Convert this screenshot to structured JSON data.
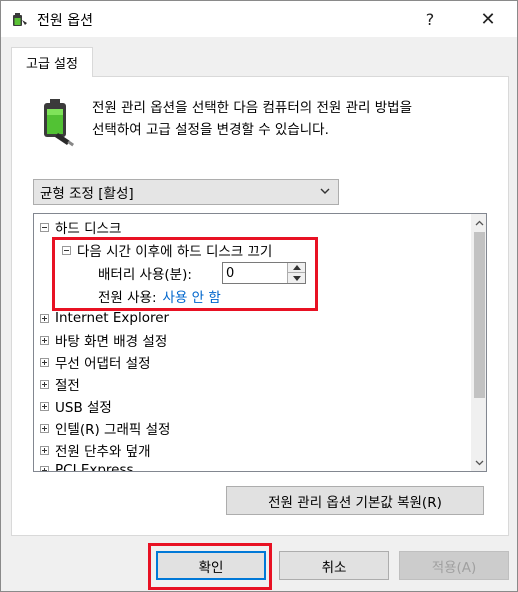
{
  "window": {
    "title": "전원 옵션",
    "help_glyph": "?",
    "close_glyph": "✕"
  },
  "tab": {
    "label": "고급 설정"
  },
  "description": {
    "line1": "전원 관리 옵션을 선택한 다음 컴퓨터의 전원 관리 방법을",
    "line2": "선택하여 고급 설정을 변경할 수 있습니다."
  },
  "plan_dropdown": {
    "value": "균형 조정 [활성]"
  },
  "tree": {
    "hard_disk": "하드 디스크",
    "turn_off_after": "다음 시간 이후에 하드 디스크 끄기",
    "on_battery_label": "배터리 사용(분):",
    "on_battery_value": "0",
    "plugged_in_label": "전원 사용:",
    "plugged_in_value": "사용 안 함",
    "items": [
      "Internet Explorer",
      "바탕 화면 배경 설정",
      "무선 어댑터 설정",
      "절전",
      "USB 설정",
      "인텔(R) 그래픽 설정",
      "전원 단추와 덮개",
      "PCI Express"
    ]
  },
  "buttons": {
    "restore": "전원 관리 옵션 기본값 복원(R)",
    "ok": "확인",
    "cancel": "취소",
    "apply": "적용(A)"
  },
  "colors": {
    "highlight": "#e81123",
    "link": "#0066cc",
    "focus_border": "#0078d7"
  }
}
